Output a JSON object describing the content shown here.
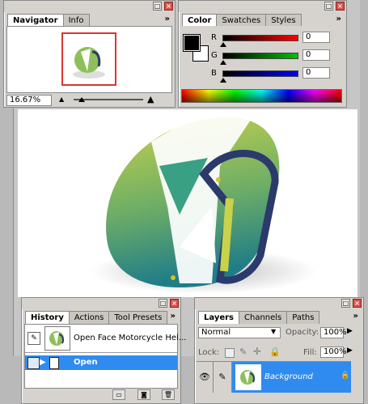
{
  "navigator_palette": {
    "tabs": [
      {
        "label": "Navigator"
      },
      {
        "label": "Info"
      }
    ],
    "zoom_value": "16.67%"
  },
  "color_palette": {
    "tabs": [
      {
        "label": "Color"
      },
      {
        "label": "Swatches"
      },
      {
        "label": "Styles"
      }
    ],
    "channels": [
      {
        "label": "R",
        "value": "0",
        "color": "#ff0000"
      },
      {
        "label": "G",
        "value": "0",
        "color": "#00c000"
      },
      {
        "label": "B",
        "value": "0",
        "color": "#0000ff"
      }
    ],
    "foreground_color": "#000000",
    "background_color": "#ffffff"
  },
  "history_palette": {
    "tabs": [
      {
        "label": "History"
      },
      {
        "label": "Actions"
      },
      {
        "label": "Tool Presets"
      }
    ],
    "snapshot_label": "Open Face Motorcycle Hel...",
    "states": [
      {
        "label": "Open",
        "selected": true
      }
    ]
  },
  "layers_palette": {
    "tabs": [
      {
        "label": "Layers"
      },
      {
        "label": "Channels"
      },
      {
        "label": "Paths"
      }
    ],
    "blend_mode": "Normal",
    "opacity_label": "Opacity:",
    "opacity_value": "100%",
    "lock_label": "Lock:",
    "fill_label": "Fill:",
    "fill_value": "100%",
    "layers": [
      {
        "name": "Background",
        "selected": true
      }
    ]
  },
  "colors": {
    "selection": "#2f8bf0",
    "helmet_green": "#b9c94a",
    "helmet_teal": "#2a8a8a",
    "helmet_trim": "#2b3a6b"
  }
}
